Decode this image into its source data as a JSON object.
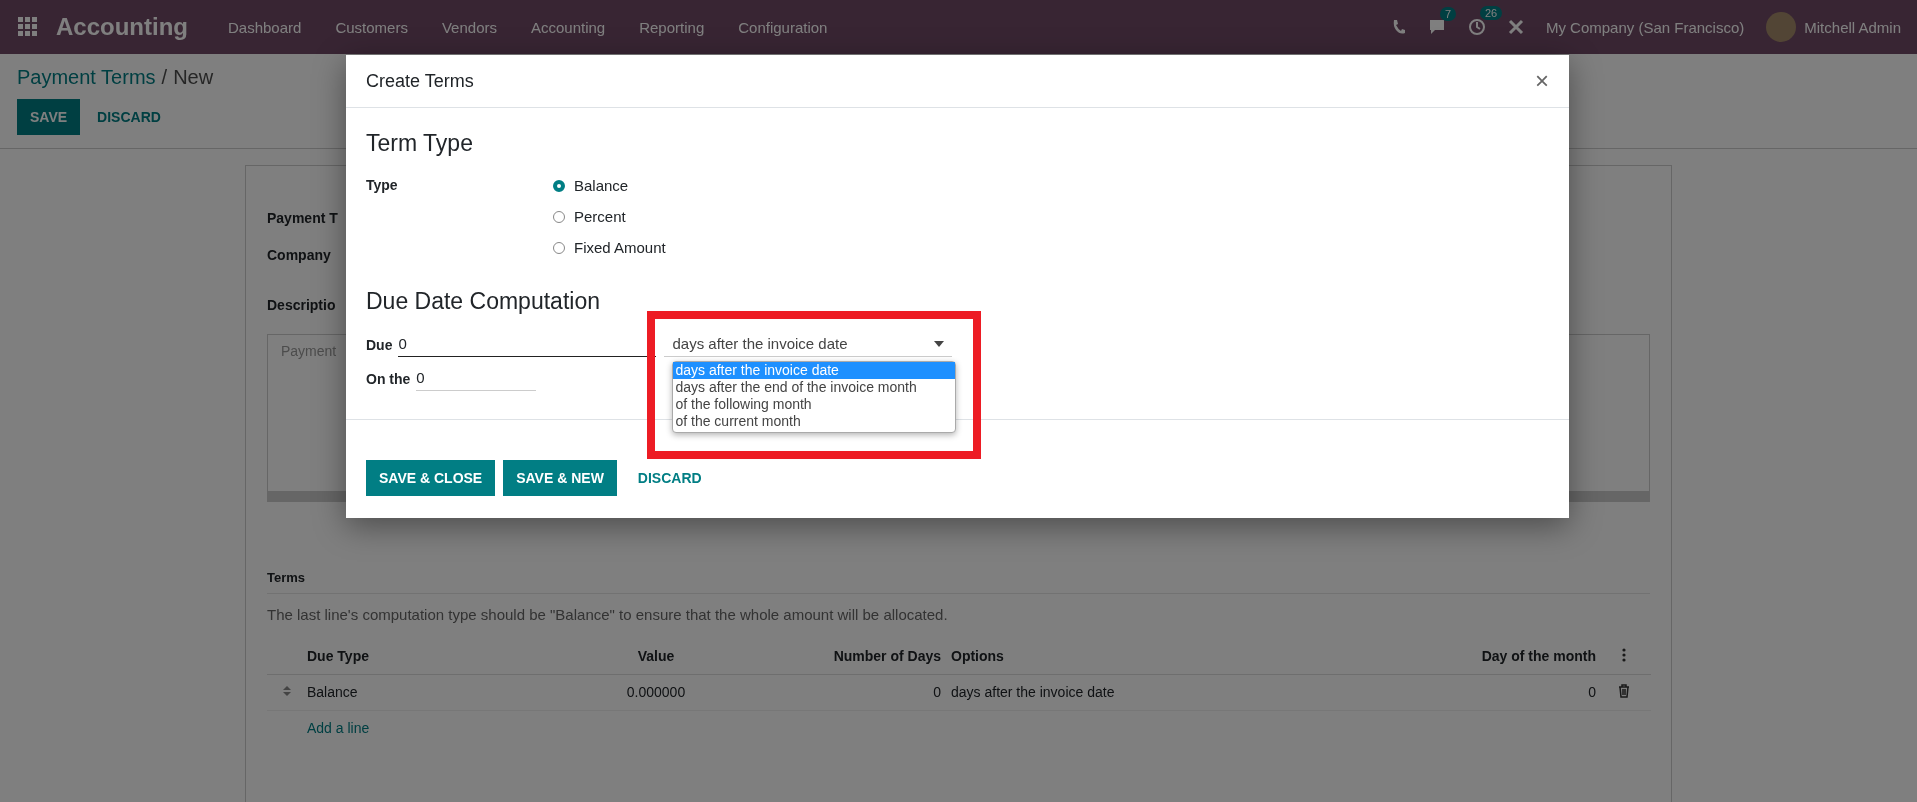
{
  "navbar": {
    "app_name": "Accounting",
    "menu": [
      "Dashboard",
      "Customers",
      "Vendors",
      "Accounting",
      "Reporting",
      "Configuration"
    ],
    "messages_count": "7",
    "activities_count": "26",
    "company": "My Company (San Francisco)",
    "user": "Mitchell Admin"
  },
  "breadcrumb": {
    "items": [
      "Payment Terms",
      "New"
    ],
    "separator": "/"
  },
  "actions": [
    {
      "label": "SAVE",
      "kind": "primary"
    },
    {
      "label": "DISCARD",
      "kind": "link"
    }
  ],
  "form": {
    "fields": [
      "Payment T",
      "Company"
    ],
    "description_label": "Descriptio",
    "description_placeholder": "Payment",
    "terms_label": "Terms",
    "note": "The last line's computation type should be \"Balance\" to ensure that the whole amount will be allocated.",
    "table": {
      "columns": [
        "Due Type",
        "Value",
        "Number of Days",
        "Options",
        "Day of the month"
      ],
      "rows": [
        {
          "cells": [
            "Balance",
            "0.000000",
            "0",
            "days after the invoice date",
            "0"
          ]
        }
      ],
      "add_line": "Add a line"
    }
  },
  "dialog": {
    "title": "Create Terms",
    "close": "×",
    "section_1": "Term Type",
    "type_label": "Type",
    "types": [
      {
        "label": "Balance",
        "selected": true
      },
      {
        "label": "Percent",
        "selected": false
      },
      {
        "label": "Fixed Amount",
        "selected": false
      }
    ],
    "section_2": "Due Date Computation",
    "due_label": "Due",
    "due_value": "0",
    "on_the_label": "On the",
    "on_the_value": "0",
    "option_value": "days after the invoice date",
    "options": [
      {
        "label": "days after the invoice date",
        "selected": true
      },
      {
        "label": "days after the end of the invoice month",
        "selected": false
      },
      {
        "label": "of the following month",
        "selected": false
      },
      {
        "label": "of the current month",
        "selected": false
      }
    ],
    "buttons": [
      {
        "label": "SAVE & CLOSE",
        "kind": "primary"
      },
      {
        "label": "SAVE & NEW",
        "kind": "primary"
      },
      {
        "label": "DISCARD",
        "kind": "link"
      }
    ]
  }
}
